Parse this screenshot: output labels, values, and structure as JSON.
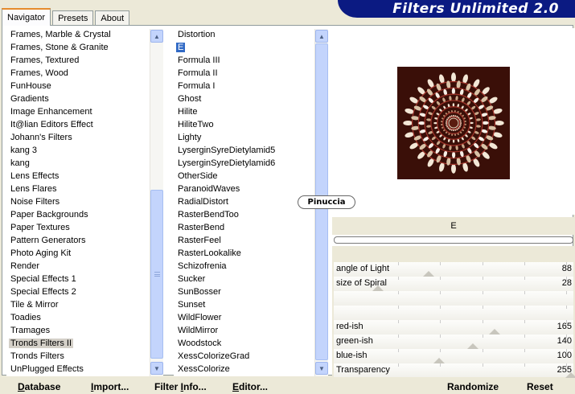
{
  "tabs": [
    {
      "label": "Navigator",
      "active": true
    },
    {
      "label": "Presets",
      "active": false
    },
    {
      "label": "About",
      "active": false
    }
  ],
  "banner_title": "Filters Unlimited 2.0",
  "categories": [
    "Frames, Marble & Crystal",
    "Frames, Stone & Granite",
    "Frames, Textured",
    "Frames, Wood",
    "FunHouse",
    "Gradients",
    "Image Enhancement",
    "It@lian Editors Effect",
    "Johann's Filters",
    "kang 3",
    "kang",
    "Lens Effects",
    "Lens Flares",
    "Noise Filters",
    "Paper Backgrounds",
    "Paper Textures",
    "Pattern Generators",
    "Photo Aging Kit",
    "Render",
    "Special Effects 1",
    "Special Effects 2",
    "Tile & Mirror",
    "Toadies",
    "Tramages",
    "Tronds Filters II",
    "Tronds Filters",
    "UnPlugged Effects"
  ],
  "selected_category": "Tronds Filters II",
  "filters": [
    "Distortion",
    "E",
    "Formula III",
    "Formula II",
    "Formula I",
    "Ghost",
    "Hilite",
    "HiliteTwo",
    "Lighty",
    "LyserginSyreDietylamid5",
    "LyserginSyreDietylamid6",
    "OtherSide",
    "ParanoidWaves",
    "RadialDistort",
    "RasterBendToo",
    "RasterBend",
    "RasterFeel",
    "RasterLookalike",
    "Schizofrenia",
    "Sucker",
    "SunBosser",
    "Sunset",
    "WildFlower",
    "WildMirror",
    "Woodstock",
    "XessColorizeGrad",
    "XessColorize"
  ],
  "selected_filter": "E",
  "watermark": "Pinuccia",
  "current_filter_name": "E",
  "parameters": [
    {
      "label": "angle of Light",
      "value": "88",
      "level": 88
    },
    {
      "label": "size of Spiral",
      "value": "28",
      "level": 28
    },
    {
      "label": "",
      "value": "",
      "level": null
    },
    {
      "label": "",
      "value": "",
      "level": null
    },
    {
      "label": "red-ish",
      "value": "165",
      "level": 165
    },
    {
      "label": "green-ish",
      "value": "140",
      "level": 140
    },
    {
      "label": "blue-ish",
      "value": "100",
      "level": 100
    },
    {
      "label": "Transparency",
      "value": "255",
      "level": 255
    }
  ],
  "buttons": {
    "database": {
      "u": "D",
      "rest": "atabase"
    },
    "import": {
      "u": "I",
      "rest": "mport..."
    },
    "filter_info": {
      "pre": "Filter ",
      "u": "I",
      "rest": "nfo..."
    },
    "editor": {
      "u": "E",
      "rest": "ditor..."
    },
    "randomize": "Randomize",
    "reset": "Reset"
  },
  "icons": {
    "scroll_up": "chevron-up-icon",
    "scroll_down": "chevron-down-icon"
  },
  "colors": {
    "banner_bg": "#0b1a82",
    "selection_blue": "#316ac5",
    "scrollbar_blue": "#c3d4fc"
  }
}
